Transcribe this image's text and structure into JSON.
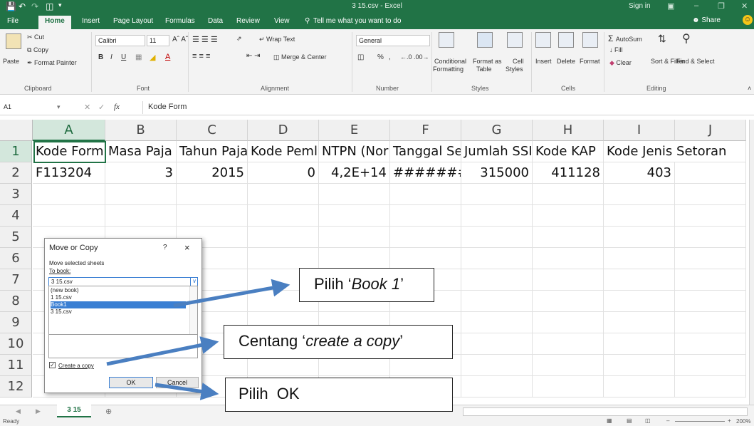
{
  "window": {
    "title": "3 15.csv - Excel",
    "sign_in": "Sign in"
  },
  "tabs": [
    "File",
    "Home",
    "Insert",
    "Page Layout",
    "Formulas",
    "Data",
    "Review",
    "View"
  ],
  "active_tab": "Home",
  "tell_me": "Tell me what you want to do",
  "share": "Share",
  "ribbon": {
    "clipboard": {
      "paste": "Paste",
      "cut": "Cut",
      "copy": "Copy",
      "format_painter": "Format Painter",
      "group": "Clipboard"
    },
    "font": {
      "name": "Calibri",
      "size": "11",
      "bold": "B",
      "italic": "I",
      "underline": "U",
      "group": "Font"
    },
    "alignment": {
      "wrap_text": "Wrap Text",
      "merge_center": "Merge & Center",
      "group": "Alignment"
    },
    "number": {
      "format": "General",
      "percent": "%",
      "comma": ",",
      "group": "Number"
    },
    "styles": {
      "conditional": "Conditional",
      "formatting": "Formatting",
      "format_as": "Format as",
      "table": "Table",
      "cell": "Cell",
      "cell_styles": "Styles",
      "group": "Styles"
    },
    "cells": {
      "insert": "Insert",
      "delete": "Delete",
      "format": "Format",
      "group": "Cells"
    },
    "editing": {
      "autosum": "AutoSum",
      "fill": "Fill",
      "clear": "Clear",
      "sort_filter": "Sort & Filter",
      "find_select": "Find & Select",
      "group": "Editing"
    }
  },
  "formula_bar": {
    "name_box": "A1",
    "fx": "fx",
    "content": "Kode Form"
  },
  "columns": [
    "A",
    "B",
    "C",
    "D",
    "E",
    "F",
    "G",
    "H",
    "I",
    "J"
  ],
  "rows": [
    "1",
    "2",
    "3",
    "4",
    "5",
    "6",
    "7",
    "8",
    "9",
    "10",
    "11",
    "12"
  ],
  "row1": [
    "Kode Form",
    "Masa Paja",
    "Tahun Paja",
    "Kode Peml",
    "NTPN (Nor",
    "Tanggal Se",
    "Jumlah SSI",
    "Kode KAP",
    "Kode Jenis Setoran",
    ""
  ],
  "row2": [
    "F113204",
    "3",
    "2015",
    "0",
    "4,2E+14",
    "########",
    "315000",
    "411128",
    "403",
    ""
  ],
  "sheet_tab": "3 15",
  "status": "Ready",
  "zoom": "200%",
  "dialog": {
    "title": "Move or Copy",
    "help": "?",
    "close": "×",
    "move_selected": "Move selected sheets",
    "to_book": "To book:",
    "book_value": "3 15.csv",
    "list": [
      "(new book)",
      "1 15.csv",
      "Book1",
      "3 15.csv"
    ],
    "selected_item": "Book1",
    "create_copy": "Create a copy",
    "create_copy_checked": true,
    "ok": "OK",
    "cancel": "Cancel"
  },
  "callouts": {
    "book1_prefix": "Pilih ‘",
    "book1_em": "Book 1",
    "book1_suffix": "’",
    "copy_prefix": "Centang ‘",
    "copy_em": "create a copy",
    "copy_suffix": "’",
    "ok_text": "Pilih  OK"
  },
  "colors": {
    "accent": "#217346",
    "arrow": "#4a7fc1",
    "selection": "#3a7fd3"
  }
}
